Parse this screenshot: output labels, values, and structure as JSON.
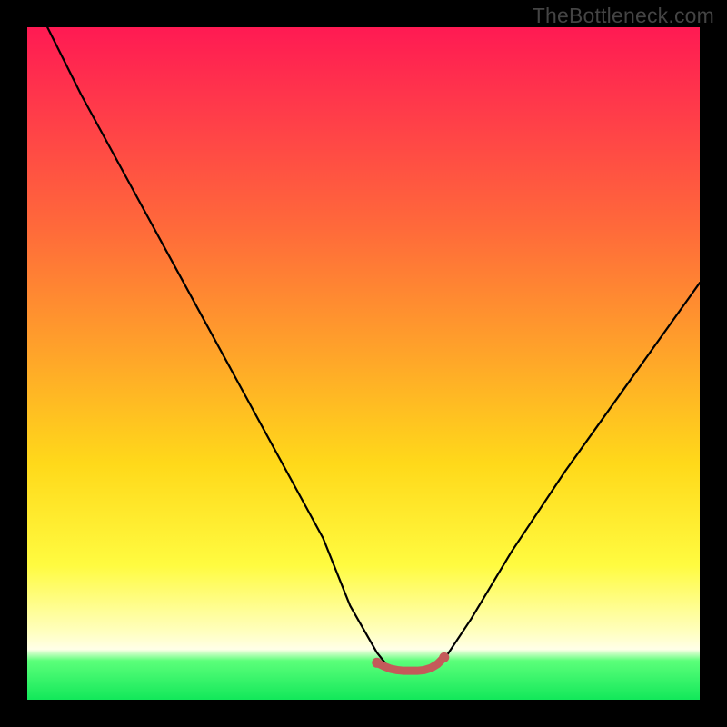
{
  "watermark": "TheBottleneck.com",
  "chart_data": {
    "type": "line",
    "title": "",
    "xlabel": "",
    "ylabel": "",
    "xlim": [
      0,
      100
    ],
    "ylim": [
      0,
      100
    ],
    "series": [
      {
        "name": "bottleneck-curve",
        "x": [
          3,
          8,
          14,
          20,
          26,
          32,
          38,
          44,
          48,
          52,
          54,
          56,
          58,
          60,
          62,
          66,
          72,
          80,
          90,
          100
        ],
        "y": [
          100,
          90,
          79,
          68,
          57,
          46,
          35,
          24,
          14,
          7,
          4.5,
          4,
          4,
          4.5,
          6,
          12,
          22,
          34,
          48,
          62
        ]
      },
      {
        "name": "flat-zone-marker",
        "x": [
          52,
          53,
          54,
          55,
          56,
          57,
          58,
          59,
          60,
          61,
          62
        ],
        "y": [
          5.5,
          5.0,
          4.6,
          4.4,
          4.3,
          4.3,
          4.3,
          4.4,
          4.7,
          5.3,
          6.3
        ]
      }
    ],
    "annotations": [],
    "legend": false,
    "background_gradient": {
      "top": "#ff1a53",
      "mid": "#ffd91a",
      "bottom_strip": "#12e85a"
    }
  }
}
